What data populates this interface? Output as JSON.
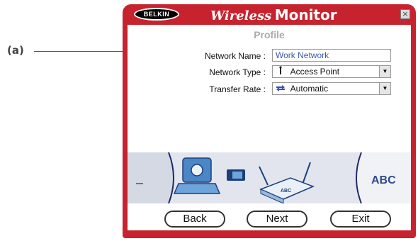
{
  "callout": {
    "label": "(a)"
  },
  "window": {
    "brand": "BELKIN",
    "title_wireless": "Wireless",
    "title_monitor": "Monitor",
    "close_glyph": "×"
  },
  "page": {
    "heading": "Profile"
  },
  "form": {
    "network_name": {
      "label": "Network Name :",
      "value": "Work Network"
    },
    "network_type": {
      "label": "Network Type :",
      "value": "Access Point",
      "icon": "access-point-icon"
    },
    "transfer_rate": {
      "label": "Transfer Rate :",
      "value": "Automatic",
      "icon": "transfer-arrows-icon"
    }
  },
  "banner": {
    "text": "ABC"
  },
  "buttons": {
    "back": "Back",
    "next": "Next",
    "exit": "Exit"
  },
  "colors": {
    "frame": "#c7232e",
    "accent_blue": "#3c5ca8",
    "banner_bg": "#e2e5ee"
  }
}
